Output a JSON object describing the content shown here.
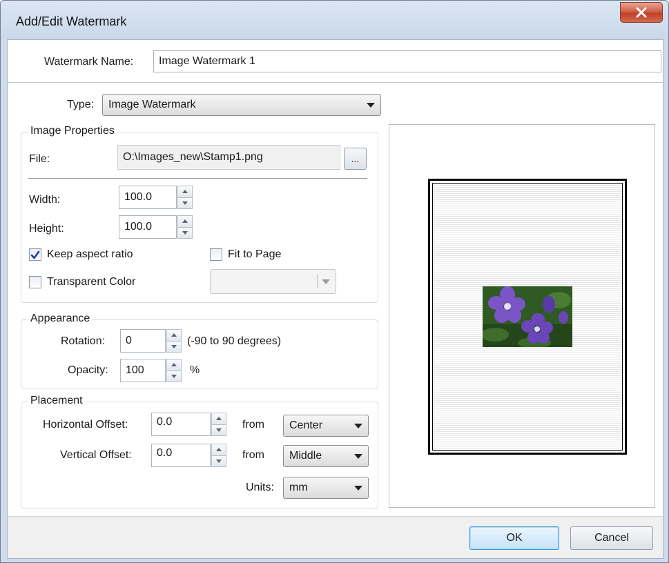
{
  "window": {
    "title": "Add/Edit Watermark",
    "close_icon": "close-x-icon",
    "colors": {
      "close": "#c7452e",
      "frame": "#cfdcec"
    }
  },
  "name": {
    "label": "Watermark Name:",
    "value": "Image Watermark 1"
  },
  "type": {
    "label": "Type:",
    "value": "Image Watermark"
  },
  "image_properties": {
    "title": "Image Properties",
    "file_label": "File:",
    "file_value": "O:\\Images_new\\Stamp1.png",
    "browse_label": "...",
    "width_label": "Width:",
    "width_value": "100.0",
    "height_label": "Height:",
    "height_value": "100.0",
    "keep_aspect_label": "Keep aspect ratio",
    "keep_aspect_checked": true,
    "fit_to_page_label": "Fit to Page",
    "fit_to_page_checked": false,
    "transparent_label": "Transparent Color",
    "transparent_checked": false
  },
  "appearance": {
    "title": "Appearance",
    "rotation_label": "Rotation:",
    "rotation_value": "0",
    "rotation_hint": "(-90 to 90 degrees)",
    "opacity_label": "Opacity:",
    "opacity_value": "100",
    "opacity_unit": "%"
  },
  "placement": {
    "title": "Placement",
    "h_offset_label": "Horizontal Offset:",
    "h_offset_value": "0.0",
    "h_from_label": "from",
    "h_from_value": "Center",
    "v_offset_label": "Vertical Offset:",
    "v_offset_value": "0.0",
    "v_from_label": "from",
    "v_from_value": "Middle",
    "units_label": "Units:",
    "units_value": "mm"
  },
  "buttons": {
    "ok": "OK",
    "cancel": "Cancel"
  }
}
